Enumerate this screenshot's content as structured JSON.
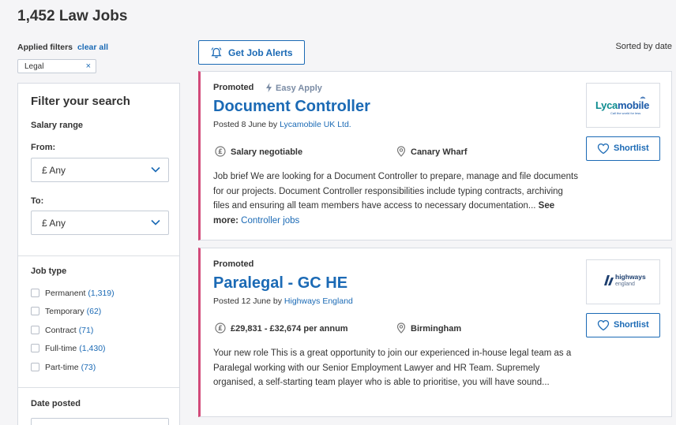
{
  "page": {
    "title": "1,452 Law Jobs"
  },
  "filters": {
    "applied_label": "Applied filters",
    "clear_all": "clear all",
    "chip": "Legal",
    "chip_remove": "×"
  },
  "sidebar": {
    "heading": "Filter your search",
    "salary_range": "Salary range",
    "from_label": "From:",
    "from_value": "£ Any",
    "to_label": "To:",
    "to_value": "£ Any",
    "job_type_label": "Job type",
    "job_types": [
      {
        "label": "Permanent",
        "count": "(1,319)"
      },
      {
        "label": "Temporary",
        "count": "(62)"
      },
      {
        "label": "Contract",
        "count": "(71)"
      },
      {
        "label": "Full-time",
        "count": "(1,430)"
      },
      {
        "label": "Part-time",
        "count": "(73)"
      }
    ],
    "date_posted_label": "Date posted"
  },
  "toolbar": {
    "alert_label": "Get Job Alerts",
    "sorted_label": "Sorted by date"
  },
  "jobs": [
    {
      "promoted": "Promoted",
      "easy_apply": "Easy Apply",
      "title": "Document Controller",
      "posted_prefix": "Posted 8 June by",
      "company": "Lycamobile UK Ltd.",
      "salary": "Salary negotiable",
      "location": "Canary Wharf",
      "description": "Job brief We are looking for a Document Controller to prepare, manage and file documents for our projects. Document Controller responsibilities include typing contracts, archiving files and ensuring all team members have access to necessary documentation...",
      "see_more": "See more:",
      "see_more_link": "Controller jobs",
      "shortlist": "Shortlist",
      "logo_text_1": "Lyca",
      "logo_text_2": "mobile",
      "logo_tagline": "Call the world for less"
    },
    {
      "promoted": "Promoted",
      "title": "Paralegal - GC HE",
      "posted_prefix": "Posted 12 June by",
      "company": "Highways England",
      "salary": "£29,831 - £32,674 per annum",
      "location": "Birmingham",
      "description": "Your new role This is a great opportunity to join our experienced in-house legal team as a Paralegal working with our Senior Employment Lawyer and HR Team. Supremely organised, a self-starting team player who is able to prioritise, you will have sound...",
      "shortlist": "Shortlist",
      "logo_text_1": "highways",
      "logo_text_2": "england"
    }
  ],
  "colors": {
    "accent": "#1b6ab5",
    "promoted_border": "#d24a7a",
    "easy_apply": "#7b8ca5"
  }
}
